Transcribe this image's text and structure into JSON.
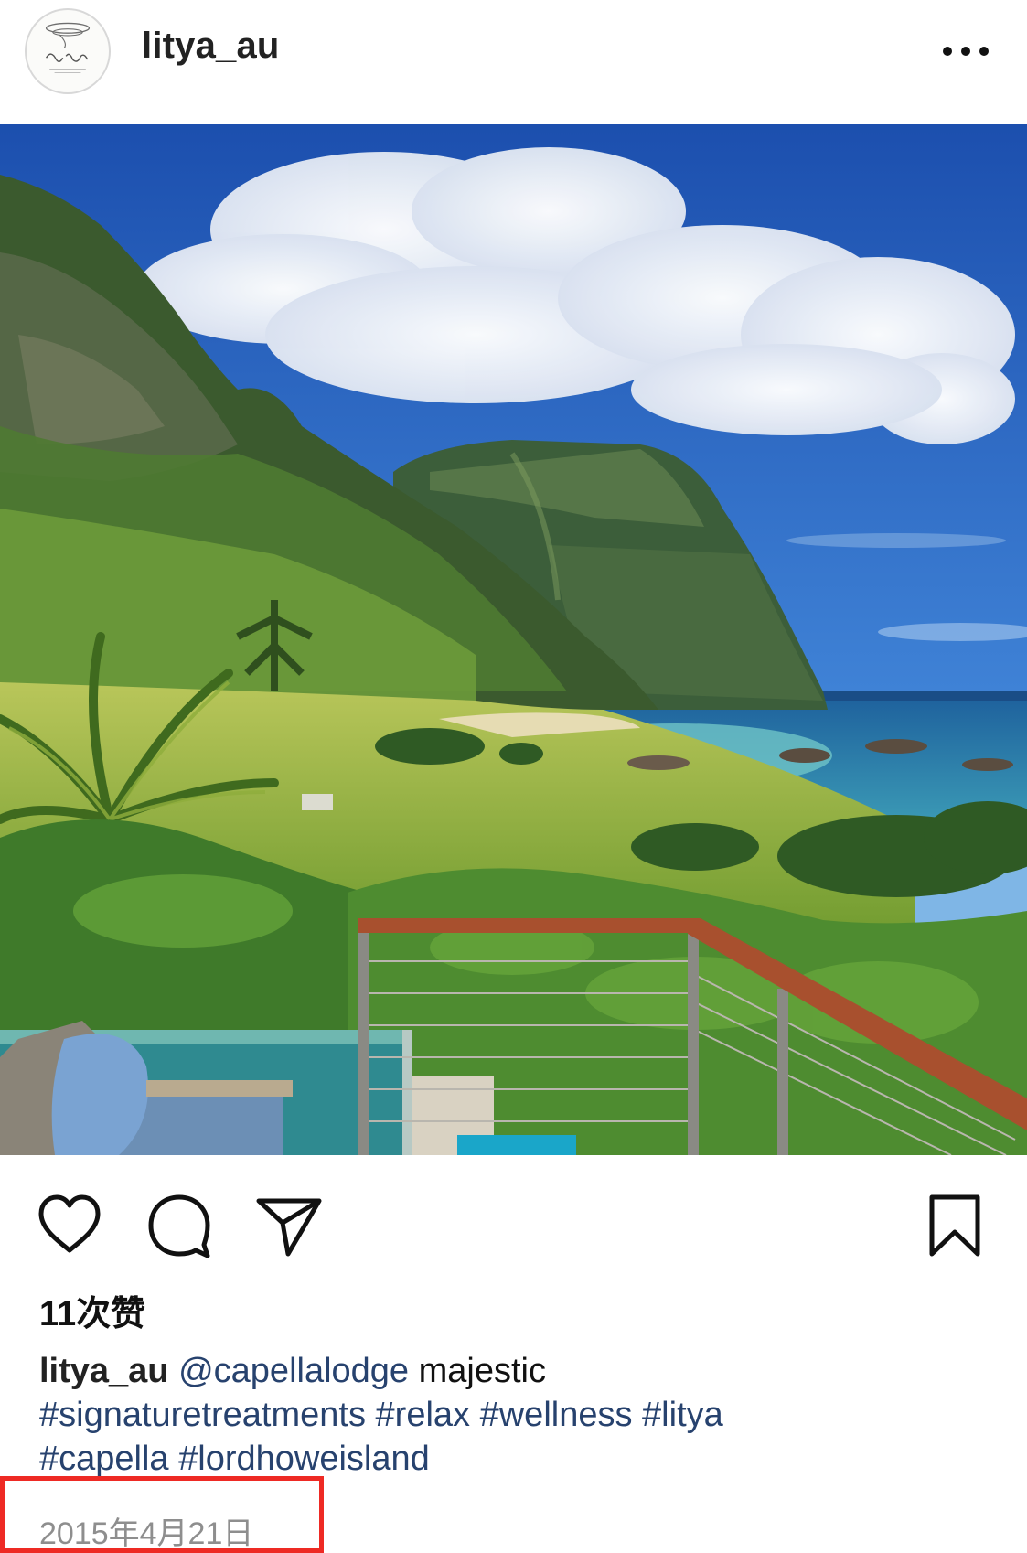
{
  "header": {
    "username": "litya_au",
    "avatar_icon": "litya-logo-avatar",
    "more_icon": "more-horizontal-icon"
  },
  "photo": {
    "icon": "landscape-photo",
    "colors": {
      "sky": "#2f6bc4",
      "cloud": "#f4f6fb",
      "mountain": "#3f5f3a",
      "grass": "#9fb84a",
      "sea": "#2e86b2",
      "railing": "#a8502e"
    }
  },
  "actions": {
    "like_icon": "heart-icon",
    "comment_icon": "comment-bubble-icon",
    "share_icon": "paper-plane-icon",
    "save_icon": "bookmark-icon"
  },
  "likes": {
    "text": "11次赞"
  },
  "caption": {
    "username": "litya_au",
    "mention": "@capellalodge",
    "text": " majestic ",
    "hashtags": [
      "#signaturetreatments",
      "#relax",
      "#wellness",
      "#litya",
      "#capella",
      "#lordhoweisland"
    ]
  },
  "date": {
    "text": "2015年4月21日",
    "highlight_color": "#ee2a24"
  }
}
